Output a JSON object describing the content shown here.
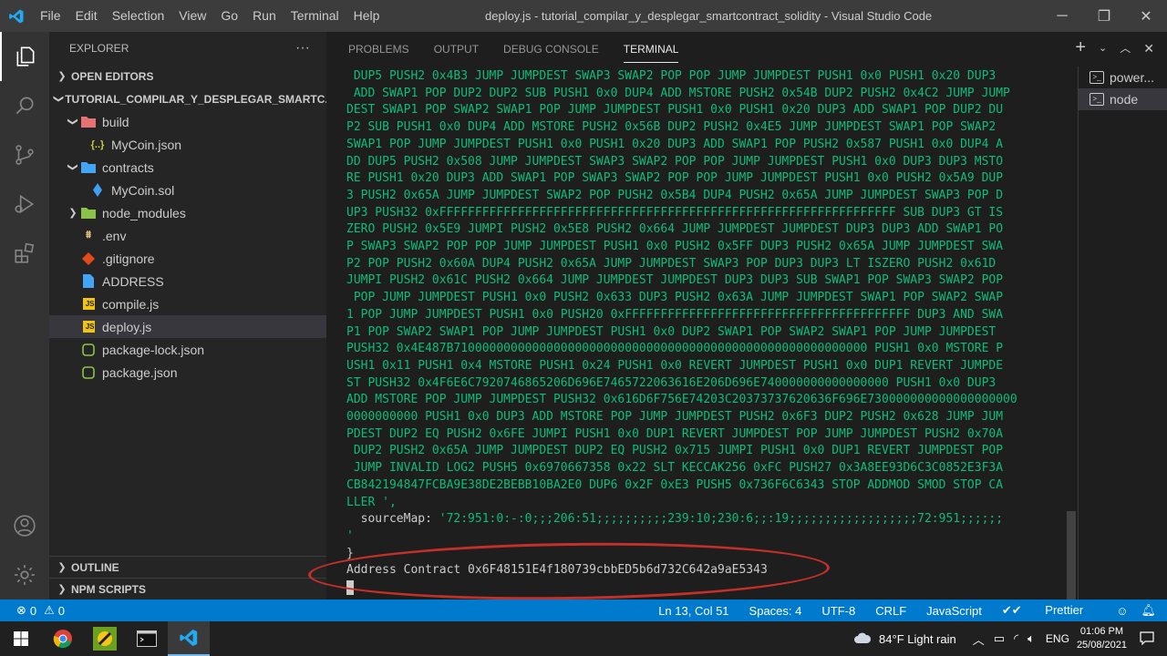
{
  "titlebar": {
    "menu": [
      "File",
      "Edit",
      "Selection",
      "View",
      "Go",
      "Run",
      "Terminal",
      "Help"
    ],
    "title": "deploy.js - tutorial_compilar_y_desplegar_smartcontract_solidity - Visual Studio Code"
  },
  "sidebar": {
    "header": "EXPLORER",
    "more": "···",
    "open_editors": "OPEN EDITORS",
    "project": "TUTORIAL_COMPILAR_Y_DESPLEGAR_SMARTC...",
    "tree": [
      {
        "label": "build",
        "icon": "folder-build-icon"
      },
      {
        "label": "MyCoin.json",
        "icon": "json-file-icon"
      },
      {
        "label": "contracts",
        "icon": "folder-contracts-icon"
      },
      {
        "label": "MyCoin.sol",
        "icon": "solidity-file-icon"
      },
      {
        "label": "node_modules",
        "icon": "folder-node-icon"
      },
      {
        "label": ".env",
        "icon": "env-file-icon"
      },
      {
        "label": ".gitignore",
        "icon": "git-file-icon"
      },
      {
        "label": "ADDRESS",
        "icon": "file-icon"
      },
      {
        "label": "compile.js",
        "icon": "js-file-icon"
      },
      {
        "label": "deploy.js",
        "icon": "js-file-icon"
      },
      {
        "label": "package-lock.json",
        "icon": "npm-file-icon"
      },
      {
        "label": "package.json",
        "icon": "npm-file-icon"
      }
    ],
    "outline": "OUTLINE",
    "npm_scripts": "NPM SCRIPTS"
  },
  "panel": {
    "tabs": [
      "PROBLEMS",
      "OUTPUT",
      "DEBUG CONSOLE",
      "TERMINAL"
    ],
    "active_tab": "TERMINAL",
    "terminal_list": [
      "power...",
      "node"
    ]
  },
  "terminal": {
    "lines": [
      " DUP5 PUSH2 0x4B3 JUMP JUMPDEST SWAP3 SWAP2 POP POP JUMP JUMPDEST PUSH1 0x0 PUSH1 0x20 DUP3",
      " ADD SWAP1 POP DUP2 DUP2 SUB PUSH1 0x0 DUP4 ADD MSTORE PUSH2 0x54B DUP2 PUSH2 0x4C2 JUMP JUMP",
      "DEST SWAP1 POP SWAP2 SWAP1 POP JUMP JUMPDEST PUSH1 0x0 PUSH1 0x20 DUP3 ADD SWAP1 POP DUP2 DU",
      "P2 SUB PUSH1 0x0 DUP4 ADD MSTORE PUSH2 0x56B DUP2 PUSH2 0x4E5 JUMP JUMPDEST SWAP1 POP SWAP2 ",
      "SWAP1 POP JUMP JUMPDEST PUSH1 0x0 PUSH1 0x20 DUP3 ADD SWAP1 POP PUSH2 0x587 PUSH1 0x0 DUP4 A",
      "DD DUP5 PUSH2 0x508 JUMP JUMPDEST SWAP3 SWAP2 POP POP JUMP JUMPDEST PUSH1 0x0 DUP3 DUP3 MSTO",
      "RE PUSH1 0x20 DUP3 ADD SWAP1 POP SWAP3 SWAP2 POP POP JUMP JUMPDEST PUSH1 0x0 PUSH2 0x5A9 DUP",
      "3 PUSH2 0x65A JUMP JUMPDEST SWAP2 POP PUSH2 0x5B4 DUP4 PUSH2 0x65A JUMP JUMPDEST SWAP3 POP D",
      "UP3 PUSH32 0xFFFFFFFFFFFFFFFFFFFFFFFFFFFFFFFFFFFFFFFFFFFFFFFFFFFFFFFFFFFFFFFF SUB DUP3 GT IS",
      "ZERO PUSH2 0x5E9 JUMPI PUSH2 0x5E8 PUSH2 0x664 JUMP JUMPDEST JUMPDEST DUP3 DUP3 ADD SWAP1 PO",
      "P SWAP3 SWAP2 POP POP JUMP JUMPDEST PUSH1 0x0 PUSH2 0x5FF DUP3 PUSH2 0x65A JUMP JUMPDEST SWA",
      "P2 POP PUSH2 0x60A DUP4 PUSH2 0x65A JUMP JUMPDEST SWAP3 POP DUP3 DUP3 LT ISZERO PUSH2 0x61D ",
      "JUMPI PUSH2 0x61C PUSH2 0x664 JUMP JUMPDEST JUMPDEST DUP3 DUP3 SUB SWAP1 POP SWAP3 SWAP2 POP",
      " POP JUMP JUMPDEST PUSH1 0x0 PUSH2 0x633 DUP3 PUSH2 0x63A JUMP JUMPDEST SWAP1 POP SWAP2 SWAP",
      "1 POP JUMP JUMPDEST PUSH1 0x0 PUSH20 0xFFFFFFFFFFFFFFFFFFFFFFFFFFFFFFFFFFFFFFFF DUP3 AND SWA",
      "P1 POP SWAP2 SWAP1 POP JUMP JUMPDEST PUSH1 0x0 DUP2 SWAP1 POP SWAP2 SWAP1 POP JUMP JUMPDEST ",
      "PUSH32 0x4E487B7100000000000000000000000000000000000000000000000000000000 PUSH1 0x0 MSTORE P",
      "USH1 0x11 PUSH1 0x4 MSTORE PUSH1 0x24 PUSH1 0x0 REVERT JUMPDEST PUSH1 0x0 DUP1 REVERT JUMPDE",
      "ST PUSH32 0x4F6E6C7920746865206D696E7465722063616E206D696E740000000000000000 PUSH1 0x0 DUP3 ",
      "ADD MSTORE POP JUMP JUMPDEST PUSH32 0x616D6F756E74203C20373737620636F696E730000000000000000000",
      "0000000000 PUSH1 0x0 DUP3 ADD MSTORE POP JUMP JUMPDEST PUSH2 0x6F3 DUP2 PUSH2 0x628 JUMP JUM",
      "PDEST DUP2 EQ PUSH2 0x6FE JUMPI PUSH1 0x0 DUP1 REVERT JUMPDEST POP JUMP JUMPDEST PUSH2 0x70A",
      " DUP2 PUSH2 0x65A JUMP JUMPDEST DUP2 EQ PUSH2 0x715 JUMPI PUSH1 0x0 DUP1 REVERT JUMPDEST POP",
      " JUMP INVALID LOG2 PUSH5 0x6970667358 0x22 SLT KECCAK256 0xFC PUSH27 0x3A8EE93D6C3C0852E3F3A",
      "CB842194847FCBA9E38DE2BEBB10BA2E0 DUP6 0x2F 0xE3 PUSH5 0x736F6C6343 STOP ADDMOD SMOD STOP CA",
      "LLER ',"
    ],
    "sourcemap_key": "  sourceMap: ",
    "sourcemap_value": "'72:951:0:-:0;;;206:51;;;;;;;;;;239:10;230:6;;:19;;;;;;;;;;;;;;;;;;72:951;;;;;;",
    "sourcemap_cont": "'",
    "closing_brace": "}",
    "address_line": "Address Contract 0x6F48151E4f180739cbbED5b6d732C642a9aE5343"
  },
  "statusbar": {
    "errors": "0",
    "warnings": "0",
    "position": "Ln 13, Col 51",
    "spaces": "Spaces: 4",
    "encoding": "UTF-8",
    "eol": "CRLF",
    "language": "JavaScript",
    "prettier": "Prettier"
  },
  "taskbar": {
    "weather": "84°F  Light rain",
    "lang": "ENG",
    "time": "01:06 PM",
    "date": "25/08/2021"
  },
  "colors": {
    "accent": "#007acc",
    "terminal_green": "#0dbc79",
    "highlight_red": "#c3302a"
  }
}
